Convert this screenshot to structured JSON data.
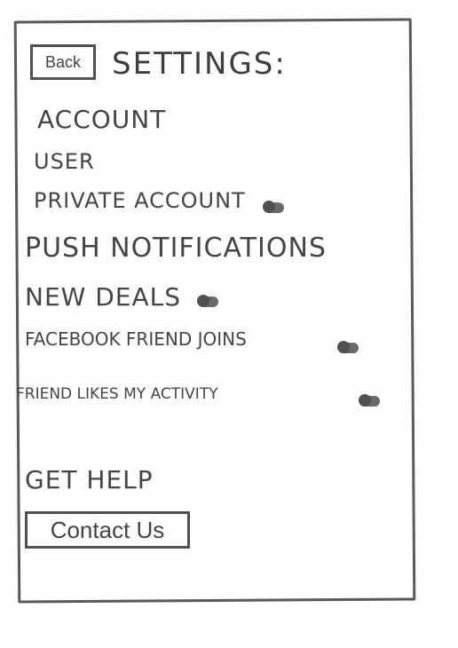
{
  "header": {
    "back_label": "Back",
    "title": "Settings:"
  },
  "sections": {
    "account_heading": "Account",
    "user": "User",
    "private_account": "Private Account",
    "push_heading": "Push Notifications",
    "new_deals": "New Deals",
    "facebook_friend_joins": "Facebook Friend Joins",
    "friend_likes_activity": "Friend Likes My Activity"
  },
  "help": {
    "heading": "Get Help",
    "contact_label": "Contact Us"
  },
  "toggles": {
    "private_account": "off",
    "new_deals": "off",
    "facebook_friend_joins": "off",
    "friend_likes_activity": "off"
  }
}
